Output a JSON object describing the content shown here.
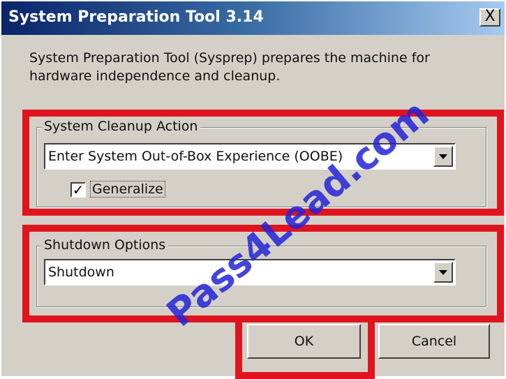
{
  "window": {
    "title": "System Preparation Tool 3.14",
    "close_label": "X",
    "description": "System Preparation Tool (Sysprep) prepares the machine for hardware independence and cleanup."
  },
  "cleanup": {
    "group_label": "System Cleanup Action",
    "selected_action": "Enter System Out-of-Box Experience (OOBE)",
    "generalize_label": "Generalize",
    "generalize_checked": true,
    "check_mark": "✓"
  },
  "shutdown": {
    "group_label": "Shutdown Options",
    "selected_option": "Shutdown"
  },
  "buttons": {
    "ok_label": "OK",
    "cancel_label": "Cancel"
  },
  "watermark": "Pass4Lead.com",
  "colors": {
    "highlight": "#e0141e",
    "watermark": "#2424d8"
  }
}
